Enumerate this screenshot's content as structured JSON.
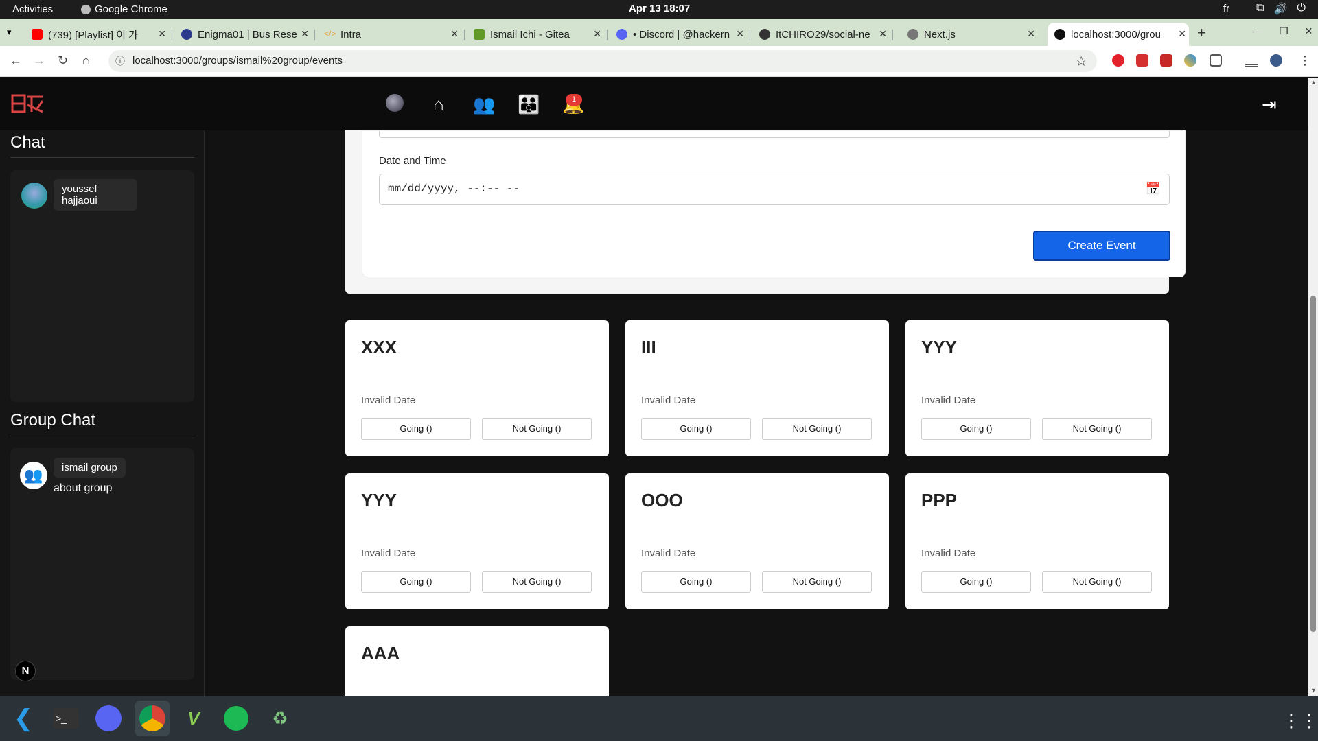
{
  "topbar": {
    "activities": "Activities",
    "app_name": "Google Chrome",
    "clock": "Apr 13  18:07",
    "lang": "fr"
  },
  "tabs": [
    {
      "title": "(739) [Playlist] 이 가",
      "fav_color": "#ff0000"
    },
    {
      "title": "Enigma01 | Bus Rese",
      "fav_color": "#2b3a8c"
    },
    {
      "title": "Intra",
      "fav_color": "#e8a13a"
    },
    {
      "title": "Ismail Ichi - Gitea",
      "fav_color": "#609926"
    },
    {
      "title": "• Discord | @hackern",
      "fav_color": "#5865f2"
    },
    {
      "title": "ItCHIRO29/social-ne",
      "fav_color": "#333333"
    },
    {
      "title": "Next.js",
      "fav_color": "#444444"
    },
    {
      "title": "localhost:3000/grou",
      "fav_color": "#111111"
    }
  ],
  "address": {
    "url": "localhost:3000/groups/ismail%20group/events"
  },
  "navbar": {
    "notification_count": "1"
  },
  "sidebar": {
    "chat_title": "Chat",
    "chat_user": "youssef\nhajjaoui",
    "group_chat_title": "Group Chat",
    "group_name": "ismail group",
    "group_desc": "about group"
  },
  "form": {
    "datetime_label": "Date and Time",
    "datetime_placeholder": "mm/dd/yyyy, --:-- --",
    "create_button": "Create Event"
  },
  "events": [
    {
      "title": "XXX",
      "date": "Invalid Date",
      "going": "Going ()",
      "not_going": "Not Going ()"
    },
    {
      "title": "III",
      "date": "Invalid Date",
      "going": "Going ()",
      "not_going": "Not Going ()"
    },
    {
      "title": "YYY",
      "date": "Invalid Date",
      "going": "Going ()",
      "not_going": "Not Going ()"
    },
    {
      "title": "YYY",
      "date": "Invalid Date",
      "going": "Going ()",
      "not_going": "Not Going ()"
    },
    {
      "title": "OOO",
      "date": "Invalid Date",
      "going": "Going ()",
      "not_going": "Not Going ()"
    },
    {
      "title": "PPP",
      "date": "Invalid Date",
      "going": "Going ()",
      "not_going": "Not Going ()"
    },
    {
      "title": "AAA",
      "date": "",
      "going": "",
      "not_going": ""
    }
  ],
  "next_indicator": "N",
  "colors": {
    "primary_button": "#1565e8",
    "badge": "#e53935",
    "page_bg": "#121212"
  }
}
